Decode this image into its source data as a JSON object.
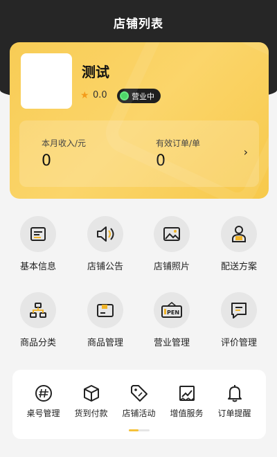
{
  "header": {
    "title": "店铺列表"
  },
  "store": {
    "name": "测试",
    "rating": "0.0",
    "status": "营业中",
    "stats": [
      {
        "label": "本月收入/元",
        "value": "0"
      },
      {
        "label": "有效订单/单",
        "value": "0"
      }
    ],
    "stats_arrow": "›"
  },
  "menu": [
    {
      "label": "基本信息",
      "icon": "document-list-icon"
    },
    {
      "label": "店铺公告",
      "icon": "speaker-icon"
    },
    {
      "label": "店铺照片",
      "icon": "image-icon"
    },
    {
      "label": "配送方案",
      "icon": "courier-icon"
    },
    {
      "label": "商品分类",
      "icon": "hierarchy-icon"
    },
    {
      "label": "商品管理",
      "icon": "wallet-icon"
    },
    {
      "label": "营业管理",
      "icon": "open-sign-icon"
    },
    {
      "label": "评价管理",
      "icon": "comment-icon"
    }
  ],
  "shortcuts": [
    {
      "label": "桌号管理",
      "icon": "hash-icon"
    },
    {
      "label": "货到付款",
      "icon": "box-icon"
    },
    {
      "label": "店铺活动",
      "icon": "tag-icon"
    },
    {
      "label": "增值服务",
      "icon": "chart-icon"
    },
    {
      "label": "订单提醒",
      "icon": "bell-icon"
    }
  ],
  "colors": {
    "accent": "#f7c94b",
    "dark": "#262626",
    "status_green": "#3fd35d"
  }
}
